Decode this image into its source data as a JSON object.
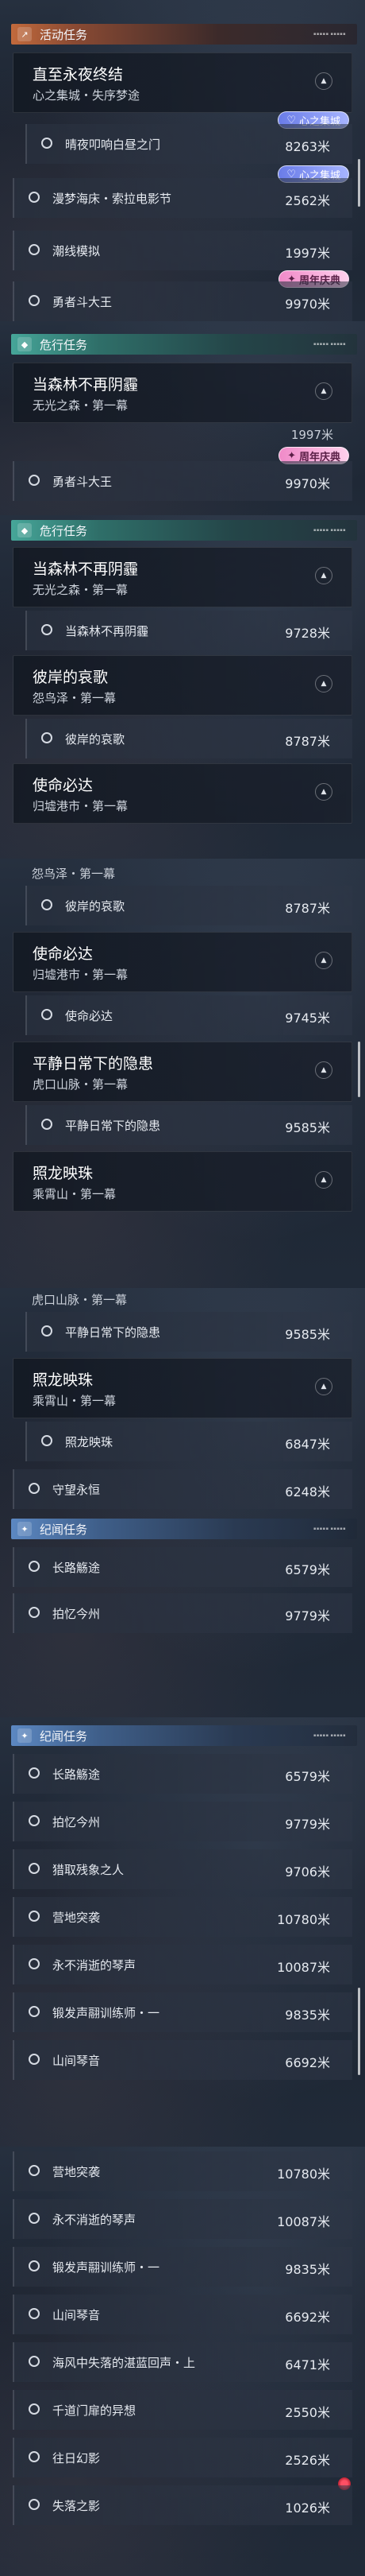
{
  "sections": {
    "activity": "活动任务",
    "danger": "危行任务",
    "memory": "纪闻任务"
  },
  "quests": {
    "eternal": {
      "title": "直至永夜终结",
      "sub": "心之集城・失序梦途"
    },
    "forest": {
      "title": "当森林不再阴霾",
      "sub": "无光之森・第一幕"
    },
    "elegy": {
      "title": "彼岸的哀歌",
      "sub": "怨鸟泽・第一幕"
    },
    "mission": {
      "title": "使命必达",
      "sub": "归墟港市・第一幕"
    },
    "hidden": {
      "title": "平静日常下的隐患",
      "sub": "虎口山脉・第一幕"
    },
    "pearl": {
      "title": "照龙映珠",
      "sub": "乘霄山・第一幕"
    }
  },
  "tasks": {
    "t1": {
      "name": "晴夜叩响白昼之门",
      "dist": "8263米"
    },
    "t2": {
      "name": "漫梦海床・索拉电影节",
      "dist": "2562米"
    },
    "t3": {
      "name": "潮线模拟",
      "dist": "1997米"
    },
    "t4": {
      "name": "勇者斗大王",
      "dist": "9970米"
    },
    "t5": {
      "name": "当森林不再阴霾",
      "dist": "9728米"
    },
    "t6": {
      "name": "彼岸的哀歌",
      "dist": "8787米"
    },
    "t7": {
      "name": "使命必达",
      "dist": "9745米"
    },
    "t8": {
      "name": "平静日常下的隐患",
      "dist": "9585米"
    },
    "t9": {
      "name": "照龙映珠",
      "dist": "6847米"
    },
    "t10": {
      "name": "守望永恒",
      "dist": "6248米"
    },
    "t11": {
      "name": "长路觞途",
      "dist": "6579米"
    },
    "t12": {
      "name": "拍忆今州",
      "dist": "9779米"
    },
    "t13": {
      "name": "猎取残象之人",
      "dist": "9706米"
    },
    "t14": {
      "name": "营地突袭",
      "dist": "10780米"
    },
    "t15": {
      "name": "永不消逝的琴声",
      "dist": "10087米"
    },
    "t16": {
      "name": "锻发声翮训练师・一",
      "dist": "9835米"
    },
    "t17": {
      "name": "山间琴音",
      "dist": "6692米"
    },
    "t18": {
      "name": "海风中失落的湛蓝回声・上",
      "dist": "6471米"
    },
    "t19": {
      "name": "千道门扉的异想",
      "dist": "2550米"
    },
    "t20": {
      "name": "往日幻影",
      "dist": "2526米"
    },
    "t21": {
      "name": "失落之影",
      "dist": "1026米"
    }
  },
  "badges": {
    "heart": "心之集城",
    "anniversary": "周年庆典"
  },
  "cut": {
    "c1": "1997米",
    "c2": "潮线模拟",
    "c3": "怨鸟泽・第一幕",
    "c4": "虎口山脉・第一幕"
  },
  "icons": {
    "section_activity": "quest-arrow-icon",
    "section_danger": "danger-diamond-icon",
    "section_memory": "memory-star-icon",
    "row_marker": "circle-marker-icon",
    "collapse": "chevron-up-icon"
  },
  "colors": {
    "activity": "#c26a3c",
    "danger": "#46a699",
    "memory": "#5c88c2"
  }
}
